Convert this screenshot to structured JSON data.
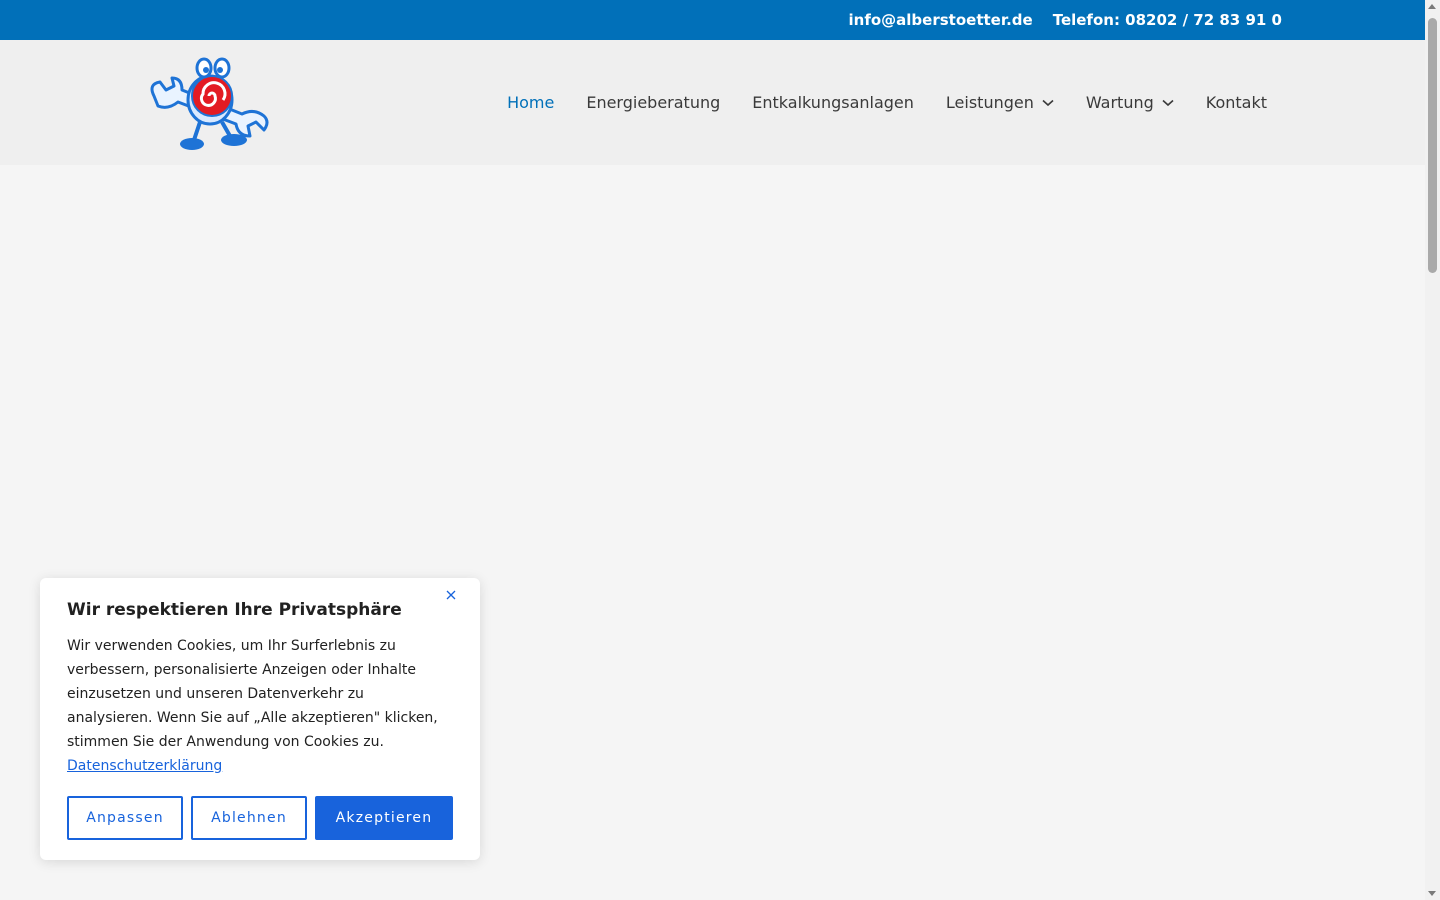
{
  "topbar": {
    "email": "info@alberstoetter.de",
    "phone": "Telefon: 08202 / 72 83 91 0"
  },
  "logo": {
    "icon": "plumber-mascot-logo"
  },
  "nav": {
    "items": [
      {
        "label": "Home",
        "active": true
      },
      {
        "label": "Energieberatung"
      },
      {
        "label": "Entkalkungsanlagen"
      },
      {
        "label": "Leistungen",
        "has_dropdown": true
      },
      {
        "label": "Wartung",
        "has_dropdown": true
      },
      {
        "label": "Kontakt"
      }
    ]
  },
  "cookie": {
    "title": "Wir respektieren Ihre Privatsphäre",
    "text": "Wir verwenden Cookies, um Ihr Surferlebnis zu verbessern, personalisierte Anzeigen oder Inhalte einzusetzen und unseren Datenverkehr zu analysieren. Wenn Sie auf „Alle akzeptieren\" klicken, stimmen Sie der Anwendung von Cookies zu.",
    "link": "Datenschutzerklärung",
    "buttons": {
      "customize": "Anpassen",
      "reject": "Ablehnen",
      "accept": "Akzeptieren"
    }
  },
  "colors": {
    "brand": "#0170b9",
    "accent": "#1863dc",
    "text": "#3a3a3a"
  }
}
